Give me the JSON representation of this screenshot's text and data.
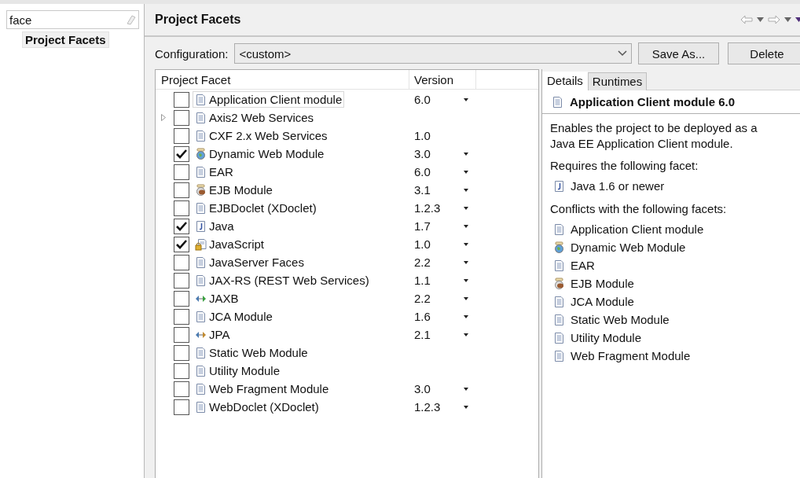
{
  "sidebar": {
    "filter": {
      "value": "face"
    },
    "items": [
      {
        "label": "Project Facets",
        "selected": true
      }
    ]
  },
  "page": {
    "title": "Project Facets"
  },
  "configuration": {
    "label": "Configuration:",
    "value": "<custom>",
    "buttons": [
      "Save As...",
      "Delete"
    ]
  },
  "table": {
    "columns": [
      "Project Facet",
      "Version"
    ],
    "rows": [
      {
        "name": "Application Client module",
        "kind": "doc",
        "checked": false,
        "selected": true,
        "expandable": false,
        "version": "6.0",
        "dropdown": true
      },
      {
        "name": "Axis2 Web Services",
        "kind": "doc",
        "checked": false,
        "selected": false,
        "expandable": true,
        "dropdown": false
      },
      {
        "name": "CXF 2.x Web Services",
        "kind": "doc",
        "checked": false,
        "selected": false,
        "expandable": false,
        "version": "1.0",
        "dropdown": false
      },
      {
        "name": "Dynamic Web Module",
        "kind": "globe",
        "checked": true,
        "selected": false,
        "expandable": false,
        "version": "3.0",
        "dropdown": true
      },
      {
        "name": "EAR",
        "kind": "doc",
        "checked": false,
        "selected": false,
        "expandable": false,
        "version": "6.0",
        "dropdown": true
      },
      {
        "name": "EJB Module",
        "kind": "bean",
        "checked": false,
        "selected": false,
        "expandable": false,
        "version": "3.1",
        "dropdown": true
      },
      {
        "name": "EJBDoclet (XDoclet)",
        "kind": "doc",
        "checked": false,
        "selected": false,
        "expandable": false,
        "version": "1.2.3",
        "dropdown": true
      },
      {
        "name": "Java",
        "kind": "java",
        "checked": true,
        "selected": false,
        "expandable": false,
        "version": "1.7",
        "dropdown": true
      },
      {
        "name": "JavaScript",
        "kind": "locked",
        "checked": true,
        "selected": false,
        "expandable": false,
        "version": "1.0",
        "dropdown": true
      },
      {
        "name": "JavaServer Faces",
        "kind": "doc",
        "checked": false,
        "selected": false,
        "expandable": false,
        "version": "2.2",
        "dropdown": true
      },
      {
        "name": "JAX-RS (REST Web Services)",
        "kind": "doc",
        "checked": false,
        "selected": false,
        "expandable": false,
        "version": "1.1",
        "dropdown": true
      },
      {
        "name": "JAXB",
        "kind": "arrows-green",
        "checked": false,
        "selected": false,
        "expandable": false,
        "version": "2.2",
        "dropdown": true
      },
      {
        "name": "JCA Module",
        "kind": "doc",
        "checked": false,
        "selected": false,
        "expandable": false,
        "version": "1.6",
        "dropdown": true
      },
      {
        "name": "JPA",
        "kind": "arrows-orange",
        "checked": false,
        "selected": false,
        "expandable": false,
        "version": "2.1",
        "dropdown": true
      },
      {
        "name": "Static Web Module",
        "kind": "doc",
        "checked": false,
        "selected": false,
        "expandable": false,
        "dropdown": false
      },
      {
        "name": "Utility Module",
        "kind": "doc",
        "checked": false,
        "selected": false,
        "expandable": false,
        "dropdown": false
      },
      {
        "name": "Web Fragment Module",
        "kind": "doc",
        "checked": false,
        "selected": false,
        "expandable": false,
        "version": "3.0",
        "dropdown": true
      },
      {
        "name": "WebDoclet (XDoclet)",
        "kind": "doc",
        "checked": false,
        "selected": false,
        "expandable": false,
        "version": "1.2.3",
        "dropdown": true
      }
    ]
  },
  "details": {
    "tabs": [
      {
        "label": "Details",
        "selected": true
      },
      {
        "label": "Runtimes",
        "selected": false
      }
    ],
    "title": {
      "text": "Application Client module 6.0",
      "kind": "doc"
    },
    "description": "Enables the project to be deployed as a Java EE Application Client module.",
    "requires_label": "Requires the following facet:",
    "requires": [
      {
        "label": "Java 1.6 or newer",
        "kind": "java"
      }
    ],
    "conflicts_label": "Conflicts with the following facets:",
    "conflicts": [
      {
        "label": "Application Client module",
        "kind": "doc"
      },
      {
        "label": "Dynamic Web Module",
        "kind": "globe"
      },
      {
        "label": "EAR",
        "kind": "doc"
      },
      {
        "label": "EJB Module",
        "kind": "bean"
      },
      {
        "label": "JCA Module",
        "kind": "doc"
      },
      {
        "label": "Static Web Module",
        "kind": "doc"
      },
      {
        "label": "Utility Module",
        "kind": "doc"
      },
      {
        "label": "Web Fragment Module",
        "kind": "doc"
      }
    ]
  }
}
